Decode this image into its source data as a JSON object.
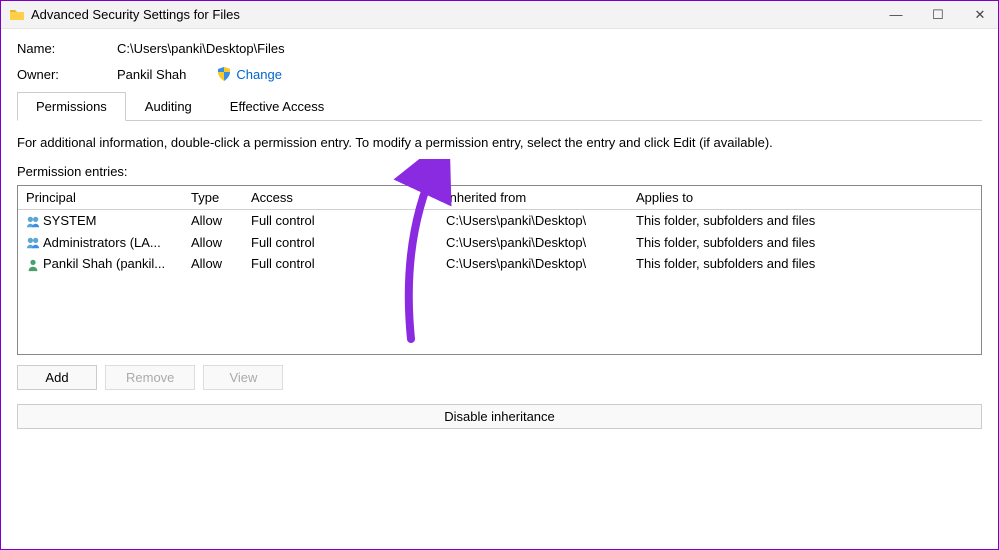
{
  "window": {
    "title": "Advanced Security Settings for Files"
  },
  "info": {
    "name_label": "Name:",
    "name_value": "C:\\Users\\panki\\Desktop\\Files",
    "owner_label": "Owner:",
    "owner_value": "Pankil Shah",
    "change_label": "Change"
  },
  "tabs": {
    "permissions": "Permissions",
    "auditing": "Auditing",
    "effective": "Effective Access"
  },
  "help_text": "For additional information, double-click a permission entry. To modify a permission entry, select the entry and click Edit (if available).",
  "entries_label": "Permission entries:",
  "columns": {
    "principal": "Principal",
    "type": "Type",
    "access": "Access",
    "inherited": "Inherited from",
    "applies": "Applies to"
  },
  "rows": [
    {
      "principal": "SYSTEM",
      "type": "Allow",
      "access": "Full control",
      "inherited": "C:\\Users\\panki\\Desktop\\",
      "applies": "This folder, subfolders and files",
      "icon": "group"
    },
    {
      "principal": "Administrators (LA...",
      "type": "Allow",
      "access": "Full control",
      "inherited": "C:\\Users\\panki\\Desktop\\",
      "applies": "This folder, subfolders and files",
      "icon": "group"
    },
    {
      "principal": "Pankil Shah (pankil...",
      "type": "Allow",
      "access": "Full control",
      "inherited": "C:\\Users\\panki\\Desktop\\",
      "applies": "This folder, subfolders and files",
      "icon": "user"
    }
  ],
  "buttons": {
    "add": "Add",
    "remove": "Remove",
    "view": "View",
    "disable_inheritance": "Disable inheritance"
  }
}
